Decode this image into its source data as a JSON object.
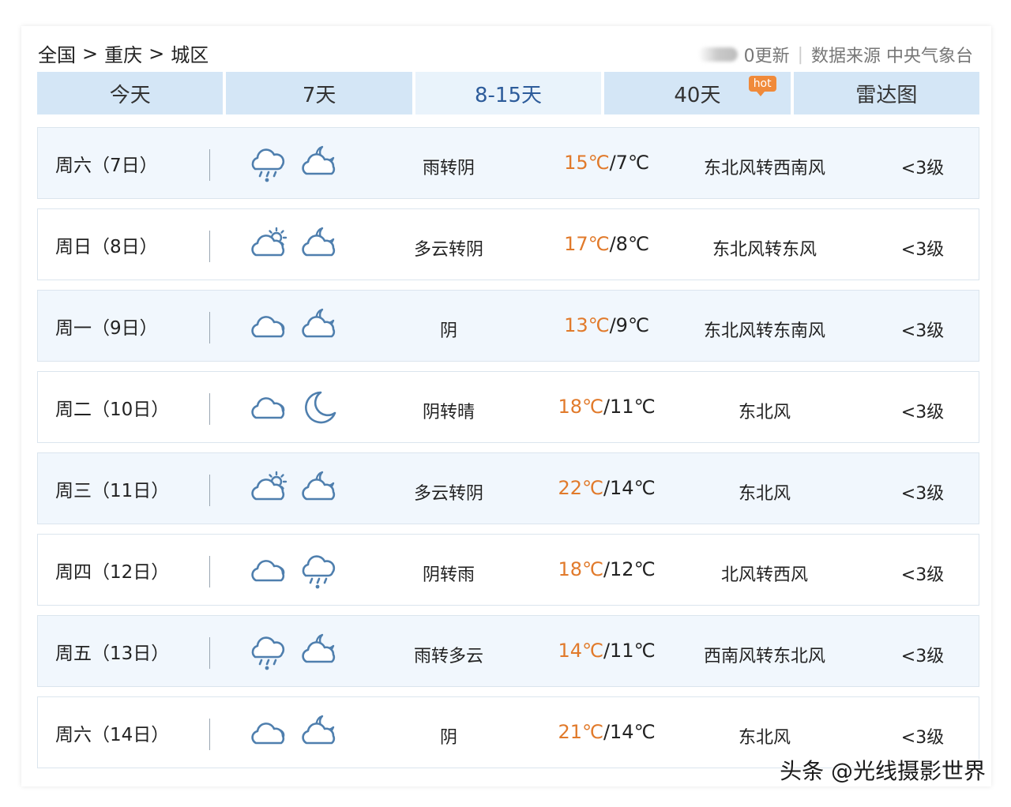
{
  "breadcrumb": {
    "country": "全国",
    "sep": ">",
    "province": "重庆",
    "district": "城区"
  },
  "meta": {
    "update": "0更新",
    "source": "数据来源 中央气象台"
  },
  "tabs": [
    {
      "label": "今天"
    },
    {
      "label": "7天"
    },
    {
      "label": "8-15天"
    },
    {
      "label": "40天",
      "badge": "hot"
    },
    {
      "label": "雷达图"
    }
  ],
  "days": [
    {
      "day": "周六（7日）",
      "icon_day": "cloud-rain-icon",
      "icon_night": "cloud-moon-icon",
      "desc": "雨转阴",
      "high": "15℃",
      "low": "/7℃",
      "wind": "东北风转西南风",
      "level": "<3级"
    },
    {
      "day": "周日（8日）",
      "icon_day": "cloud-sun-icon",
      "icon_night": "cloud-moon-icon",
      "desc": "多云转阴",
      "high": "17℃",
      "low": "/8℃",
      "wind": "东北风转东风",
      "level": "<3级"
    },
    {
      "day": "周一（9日）",
      "icon_day": "cloud-icon",
      "icon_night": "cloud-moon-icon",
      "desc": "阴",
      "high": "13℃",
      "low": "/9℃",
      "wind": "东北风转东南风",
      "level": "<3级"
    },
    {
      "day": "周二（10日）",
      "icon_day": "cloud-icon",
      "icon_night": "moon-icon",
      "desc": "阴转晴",
      "high": "18℃",
      "low": "/11℃",
      "wind": "东北风",
      "level": "<3级"
    },
    {
      "day": "周三（11日）",
      "icon_day": "cloud-sun-icon",
      "icon_night": "cloud-moon-icon",
      "desc": "多云转阴",
      "high": "22℃",
      "low": "/14℃",
      "wind": "东北风",
      "level": "<3级"
    },
    {
      "day": "周四（12日）",
      "icon_day": "cloud-icon",
      "icon_night": "cloud-rain-icon",
      "desc": "阴转雨",
      "high": "18℃",
      "low": "/12℃",
      "wind": "北风转西风",
      "level": "<3级"
    },
    {
      "day": "周五（13日）",
      "icon_day": "cloud-rain-icon",
      "icon_night": "cloud-moon-icon",
      "desc": "雨转多云",
      "high": "14℃",
      "low": "/11℃",
      "wind": "西南风转东北风",
      "level": "<3级"
    },
    {
      "day": "周六（14日）",
      "icon_day": "cloud-icon",
      "icon_night": "cloud-moon-icon",
      "desc": "阴",
      "high": "21℃",
      "low": "/14℃",
      "wind": "东北风",
      "level": "<3级"
    }
  ],
  "watermark": "头条 @光线摄影世界",
  "colors": {
    "tab_bg": "#d4e6f6",
    "tab_active_bg": "#e9f3fb",
    "row_alt_bg": "#f1f7fd",
    "high_temp": "#e17a2b",
    "icon_stroke": "#4f7fae",
    "hot_badge": "#f08a3a"
  }
}
